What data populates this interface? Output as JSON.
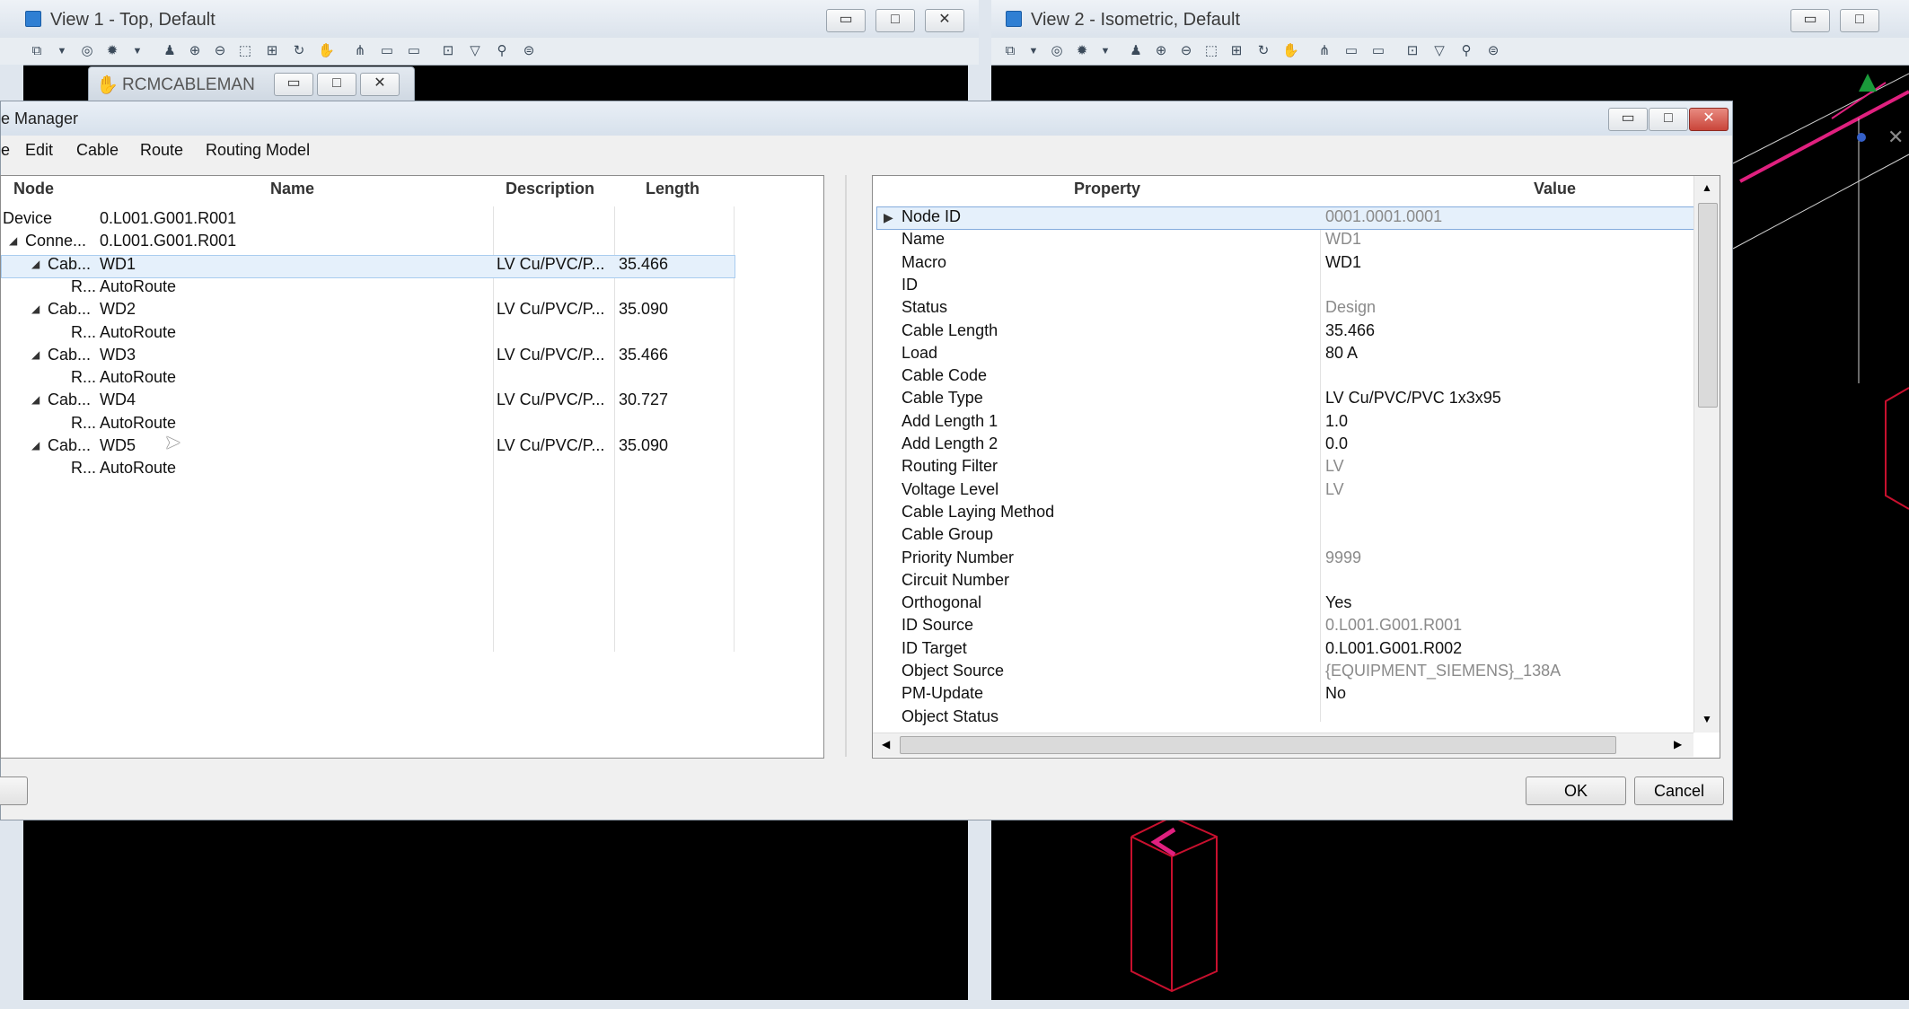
{
  "view1": {
    "title": "View 1 - Top, Default"
  },
  "view2": {
    "title": "View 2 - Isometric, Default"
  },
  "window_controls": {
    "minimize": "▭",
    "maximize": "□",
    "close": "✕"
  },
  "rcm": {
    "title": "RCMCABLEMAN"
  },
  "dialog": {
    "title": "e Manager",
    "menu": [
      "e",
      "Edit",
      "Cable",
      "Route",
      "Routing Model"
    ],
    "ok": "OK",
    "cancel": "Cancel"
  },
  "tree": {
    "headers": {
      "node": "Node",
      "name": "Name",
      "description": "Description",
      "length": "Length"
    },
    "rows": [
      {
        "node": "Device",
        "name": "0.L001.G001.R001",
        "description": "",
        "length": "",
        "expander": ""
      },
      {
        "node": "Conne...",
        "name": "0.L001.G001.R001",
        "description": "",
        "length": "",
        "expander": "◢"
      },
      {
        "node": "Cab...",
        "name": "WD1",
        "description": "LV Cu/PVC/P...",
        "length": "35.466",
        "expander": "◢"
      },
      {
        "node": "R...",
        "name": "AutoRoute",
        "description": "",
        "length": "",
        "expander": ""
      },
      {
        "node": "Cab...",
        "name": "WD2",
        "description": "LV Cu/PVC/P...",
        "length": "35.090",
        "expander": "◢"
      },
      {
        "node": "R...",
        "name": "AutoRoute",
        "description": "",
        "length": "",
        "expander": ""
      },
      {
        "node": "Cab...",
        "name": "WD3",
        "description": "LV Cu/PVC/P...",
        "length": "35.466",
        "expander": "◢"
      },
      {
        "node": "R...",
        "name": "AutoRoute",
        "description": "",
        "length": "",
        "expander": ""
      },
      {
        "node": "Cab...",
        "name": "WD4",
        "description": "LV Cu/PVC/P...",
        "length": "30.727",
        "expander": "◢"
      },
      {
        "node": "R...",
        "name": "AutoRoute",
        "description": "",
        "length": "",
        "expander": ""
      },
      {
        "node": "Cab...",
        "name": "WD5",
        "description": "LV Cu/PVC/P...",
        "length": "35.090",
        "expander": "◢"
      },
      {
        "node": "R...",
        "name": "AutoRoute",
        "description": "",
        "length": "",
        "expander": ""
      }
    ]
  },
  "properties": {
    "headers": {
      "property": "Property",
      "value": "Value"
    },
    "rows": [
      {
        "property": "Node ID",
        "value": "0001.0001.0001",
        "readonly": true
      },
      {
        "property": "Name",
        "value": "WD1",
        "readonly": true
      },
      {
        "property": "Macro",
        "value": "WD1",
        "readonly": false
      },
      {
        "property": "ID",
        "value": "",
        "readonly": false
      },
      {
        "property": "Status",
        "value": "Design",
        "readonly": true
      },
      {
        "property": "Cable Length",
        "value": "35.466",
        "readonly": false
      },
      {
        "property": "Load",
        "value": "80   A",
        "readonly": false
      },
      {
        "property": "Cable Code",
        "value": "",
        "readonly": false
      },
      {
        "property": "Cable Type",
        "value": "LV Cu/PVC/PVC 1x3x95",
        "readonly": false
      },
      {
        "property": "Add Length 1",
        "value": "1.0",
        "readonly": false
      },
      {
        "property": "Add Length 2",
        "value": "0.0",
        "readonly": false
      },
      {
        "property": "Routing Filter",
        "value": "LV",
        "readonly": true
      },
      {
        "property": "Voltage Level",
        "value": "LV",
        "readonly": true
      },
      {
        "property": "Cable Laying Method",
        "value": "",
        "readonly": false
      },
      {
        "property": "Cable Group",
        "value": "",
        "readonly": false
      },
      {
        "property": "Priority Number",
        "value": "9999",
        "readonly": true
      },
      {
        "property": "Circuit Number",
        "value": "",
        "readonly": false
      },
      {
        "property": "Orthogonal",
        "value": "Yes",
        "readonly": false
      },
      {
        "property": "ID Source",
        "value": "0.L001.G001.R001",
        "readonly": true
      },
      {
        "property": "ID Target",
        "value": "0.L001.G001.R002",
        "readonly": false
      },
      {
        "property": "Object Source",
        "value": "{EQUIPMENT_SIEMENS}_138A",
        "readonly": true
      },
      {
        "property": "PM-Update",
        "value": "No",
        "readonly": false
      },
      {
        "property": "Object Status",
        "value": "",
        "readonly": false
      }
    ]
  },
  "colors": {
    "selection": "#e5f0fb",
    "close_red": "#d9534f",
    "magenta": "#e0207f",
    "crimson": "#c8102e"
  }
}
